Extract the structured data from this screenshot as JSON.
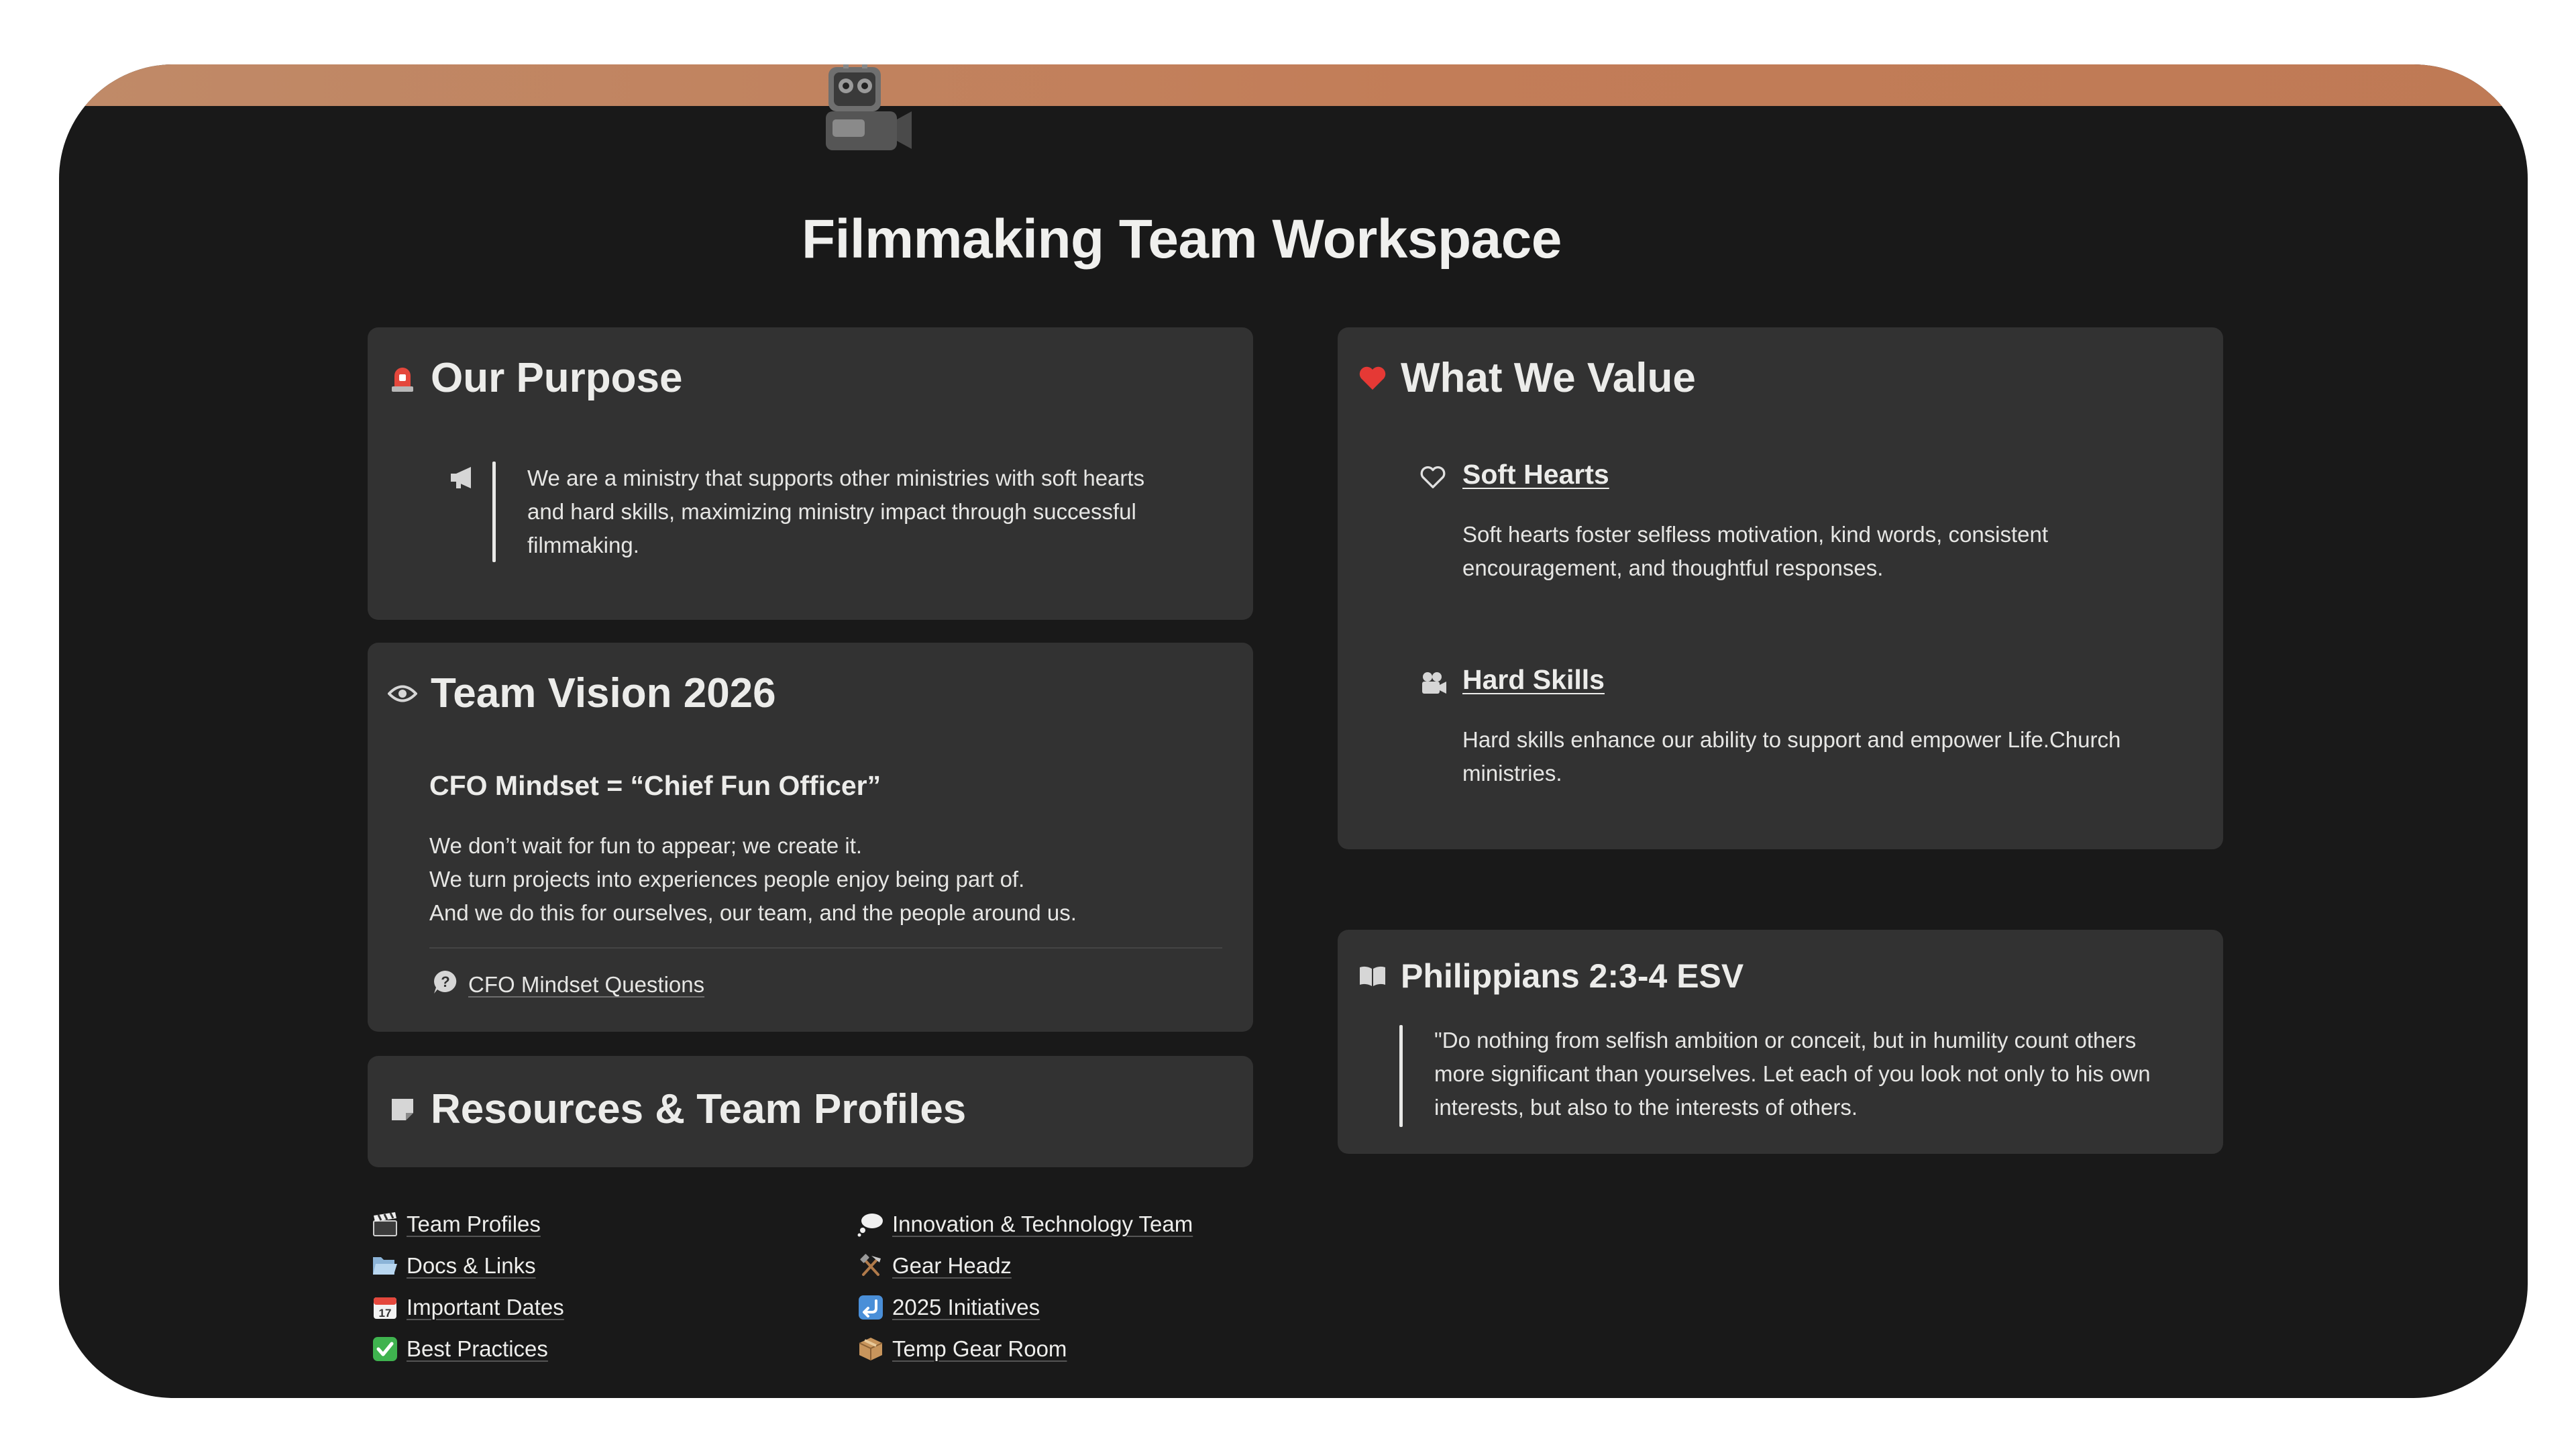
{
  "page": {
    "title": "Filmmaking Team Workspace",
    "icon": "movie-camera-robot-icon",
    "cover_color": "#c27d58",
    "background": "#191919"
  },
  "purpose": {
    "title": "Our Purpose",
    "icon": "rotating-light-icon",
    "callout_icon": "megaphone-icon",
    "text": "We are a ministry that supports other ministries with soft hearts and hard skills, maximizing ministry impact through successful filmmaking."
  },
  "vision": {
    "title": "Team Vision 2026",
    "icon": "eye-icon",
    "subtitle": "CFO Mindset = “Chief Fun Officer”",
    "lines": [
      "We don’t wait for fun to appear; we create it.",
      "We turn projects into experiences people enjoy being part of.",
      "And we do this for ourselves, our team, and the people around us."
    ],
    "link": {
      "label": "CFO Mindset Questions",
      "icon": "question-bubble-icon"
    }
  },
  "resources": {
    "title": "Resources & Team Profiles",
    "icon": "note-icon",
    "left": [
      {
        "icon": "clapperboard-icon",
        "label": "Team Profiles"
      },
      {
        "icon": "open-folder-icon",
        "label": "Docs & Links"
      },
      {
        "icon": "calendar-icon",
        "label": "Important Dates"
      },
      {
        "icon": "check-mark-icon",
        "label": "Best Practices"
      }
    ],
    "right": [
      {
        "icon": "thought-bubble-icon",
        "label": "Innovation & Technology Team"
      },
      {
        "icon": "hammer-pick-icon",
        "label": "Gear Headz"
      },
      {
        "icon": "return-arrow-icon",
        "label": "2025 Initiatives"
      },
      {
        "icon": "package-icon",
        "label": "Temp Gear Room"
      }
    ]
  },
  "values": {
    "title": "What We Value",
    "icon": "red-heart-icon",
    "items": [
      {
        "icon": "heart-outline-icon",
        "title": "Soft Hearts",
        "text": "Soft hearts foster selfless motivation, kind words, consistent encouragement, and thoughtful responses."
      },
      {
        "icon": "movie-camera-icon",
        "title": "Hard Skills",
        "text": "Hard skills enhance our ability to support and empower Life.Church ministries."
      }
    ]
  },
  "scripture": {
    "title": "Philippians 2:3-4 ESV",
    "icon": "open-book-icon",
    "text": "\"Do nothing from selfish ambition or conceit, but in humility count others more significant than yourselves. Let each of you look not only to his own interests, but also to the interests of others."
  }
}
